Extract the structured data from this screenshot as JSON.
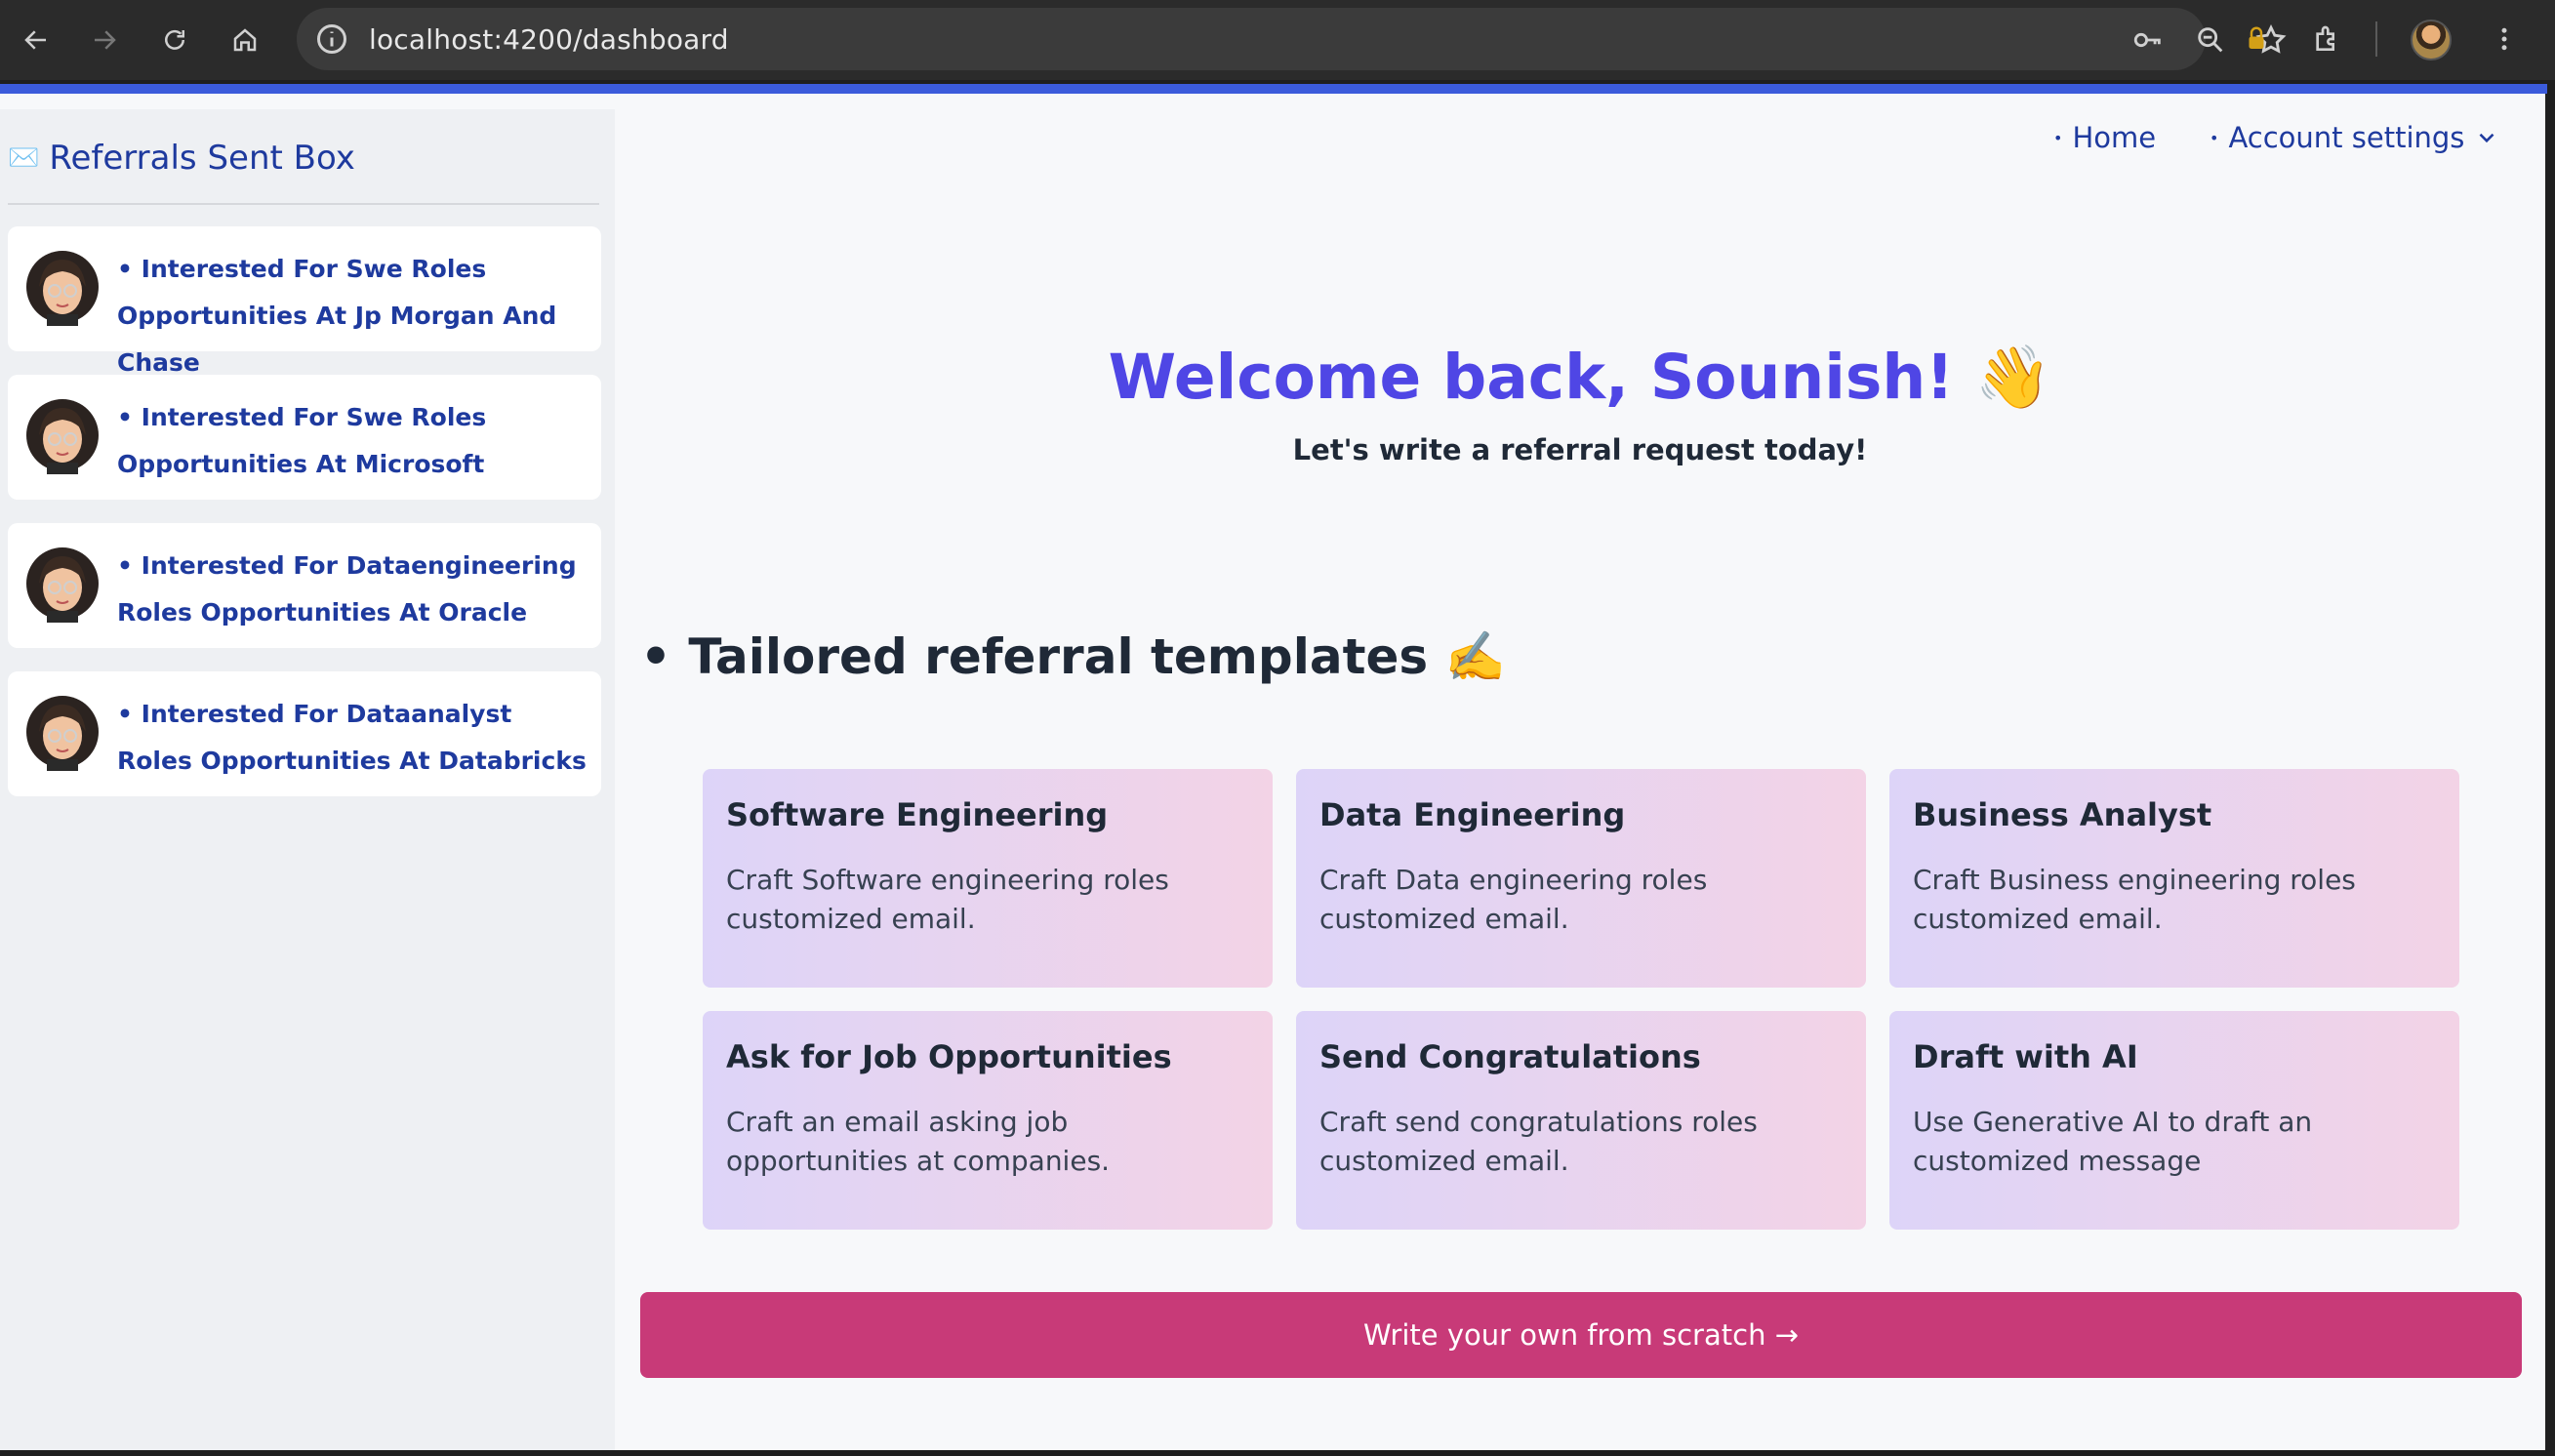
{
  "browser": {
    "url": "localhost:4200/dashboard"
  },
  "sidebar": {
    "title": "Referrals Sent Box",
    "title_icon": "envelope-icon",
    "items": [
      {
        "label": "• Interested For Swe Roles Opportunities At Jp Morgan And Chase"
      },
      {
        "label": "• Interested For Swe Roles Opportunities At Microsoft"
      },
      {
        "label": "• Interested For Dataengineering Roles Opportunities At Oracle"
      },
      {
        "label": "• Interested For Dataanalyst Roles Opportunities At Databricks"
      }
    ]
  },
  "nav": {
    "home": "Home",
    "account": "Account settings"
  },
  "hero": {
    "welcome": "Welcome back, Sounish! 👋",
    "subtitle": "Let's write a referral request today!"
  },
  "templates": {
    "heading": "• Tailored referral templates ✍️",
    "cards": [
      {
        "title": "Software Engineering",
        "desc": "Craft Software engineering roles customized email."
      },
      {
        "title": "Data Engineering",
        "desc": "Craft Data engineering roles customized email."
      },
      {
        "title": "Business Analyst",
        "desc": "Craft Business engineering roles customized email."
      },
      {
        "title": "Ask for Job Opportunities",
        "desc": "Craft an email asking job opportunities at companies."
      },
      {
        "title": "Send Congratulations",
        "desc": "Craft send congratulations roles customized email."
      },
      {
        "title": "Draft with AI",
        "desc": "Use Generative AI to draft an customized message"
      }
    ]
  },
  "cta": {
    "label": "Write your own from scratch →"
  },
  "colors": {
    "accent": "#4f46e5",
    "link": "#1e3a9e",
    "cta": "#c83a78",
    "browser_bar": "#3b5bdb"
  }
}
